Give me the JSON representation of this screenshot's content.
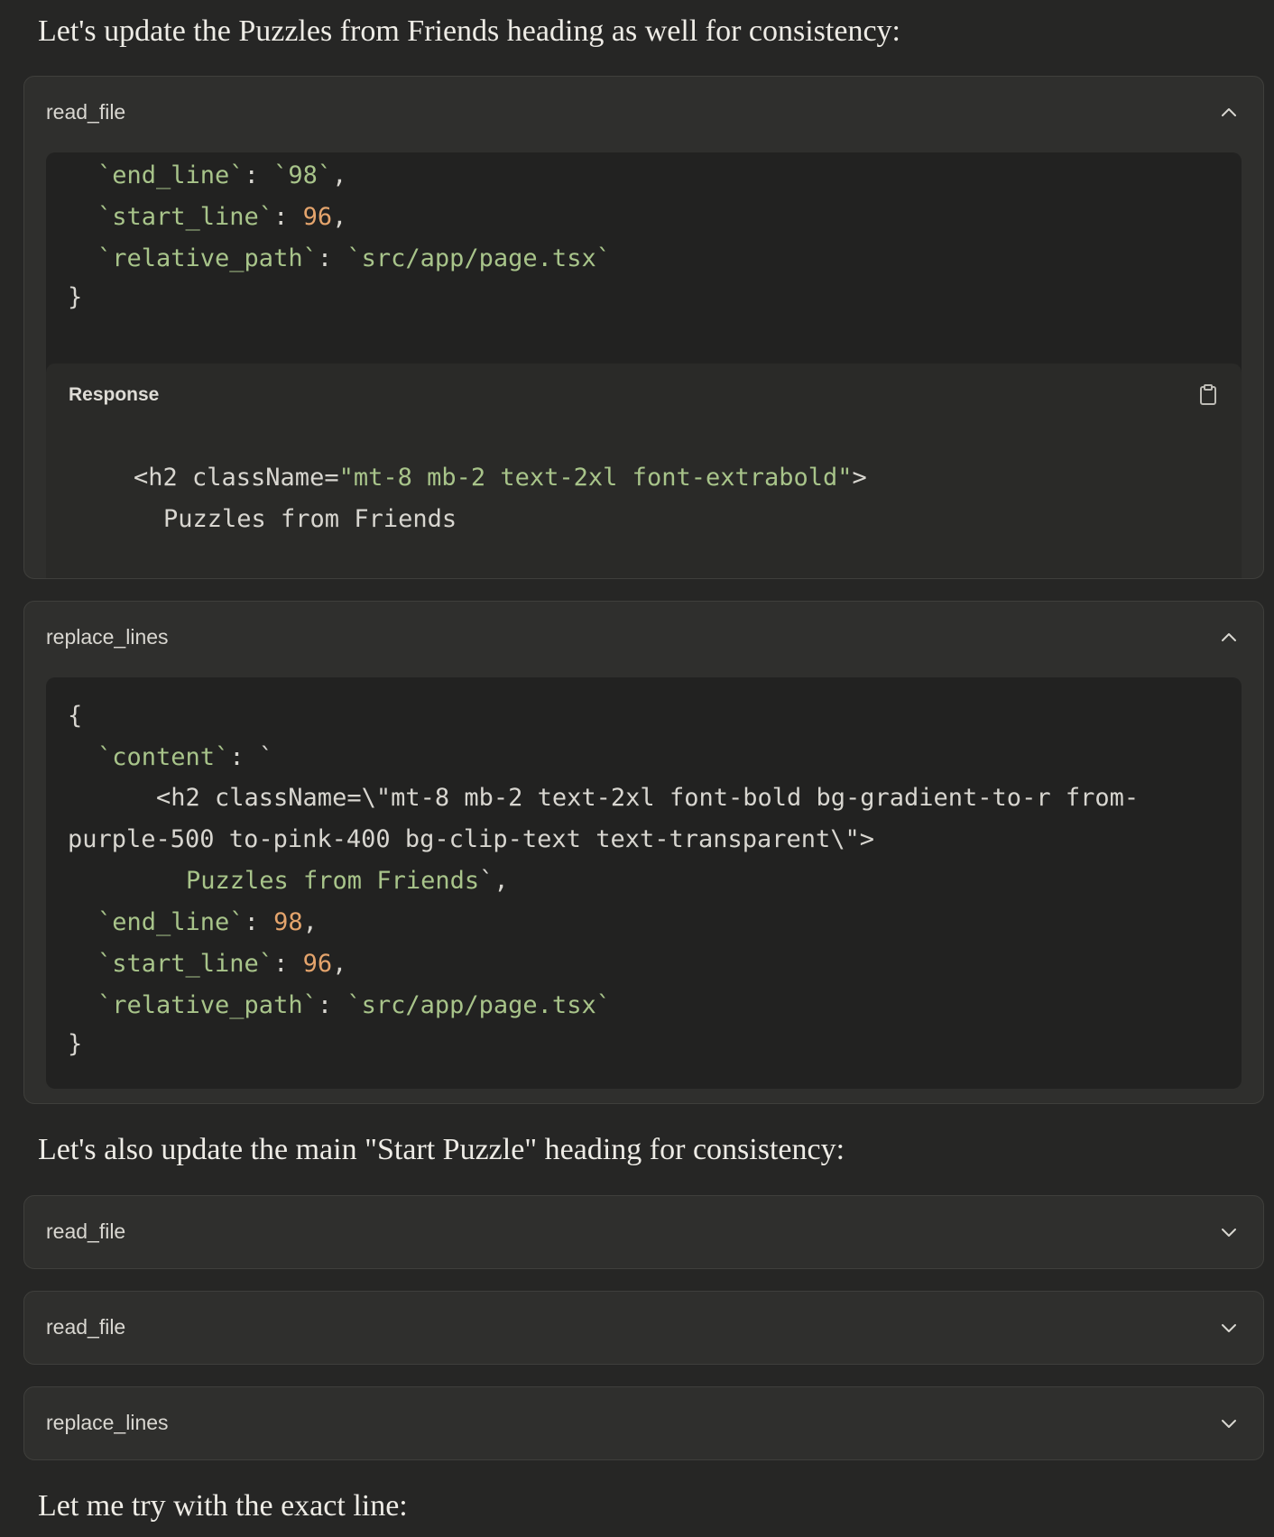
{
  "messages": {
    "m1": "Let's update the Puzzles from Friends heading as well for consistency:",
    "m2": "Let's also update the main \"Start Puzzle\" heading for consistency:",
    "m3": "Let me try with the exact line:"
  },
  "tool1": {
    "name": "read_file",
    "lines": [
      {
        "k": "`end_line`",
        "sep": ": ",
        "v": "`98`",
        "vt": "s",
        "tail": ","
      },
      {
        "k": "`start_line`",
        "sep": ": ",
        "v": "96",
        "vt": "n",
        "tail": ","
      },
      {
        "k": "`relative_path`",
        "sep": ": ",
        "v": "`src/app/page.tsx`",
        "vt": "s",
        "tail": ""
      }
    ],
    "close": "}",
    "response": {
      "title": "Response",
      "line1_tag": "<h2 className=",
      "line1_attr": "\"mt-8 mb-2 text-2xl font-extrabold\"",
      "line1_end": ">",
      "line2": "Puzzles from Friends"
    }
  },
  "tool2": {
    "name": "replace_lines",
    "open": "{",
    "content_key": "`content`",
    "content_sep": ": `",
    "c_line1": "<h2 className=\\\"mt-8 mb-2 text-2xl font-bold bg-gradient-to-r from-",
    "c_line2": "purple-500 to-pink-400 bg-clip-text text-transparent\\\">",
    "c_line3_text": "Puzzles from Friends",
    "c_line3_tail": "`,",
    "lines": [
      {
        "k": "`end_line`",
        "sep": ": ",
        "v": "98",
        "vt": "n",
        "tail": ","
      },
      {
        "k": "`start_line`",
        "sep": ": ",
        "v": "96",
        "vt": "n",
        "tail": ","
      },
      {
        "k": "`relative_path`",
        "sep": ": ",
        "v": "`src/app/page.tsx`",
        "vt": "s",
        "tail": ""
      }
    ],
    "close": "}"
  },
  "collapsed": [
    {
      "name": "read_file"
    },
    {
      "name": "read_file"
    },
    {
      "name": "replace_lines"
    }
  ],
  "icons": {
    "expanded": "chevron-up-icon",
    "collapsed": "chevron-down-icon",
    "copy": "clipboard-icon"
  },
  "colors": {
    "background": "#262625",
    "card": "#2f2f2d",
    "code_bg": "#222221",
    "string": "#a8c48a",
    "number": "#e4a46c"
  }
}
